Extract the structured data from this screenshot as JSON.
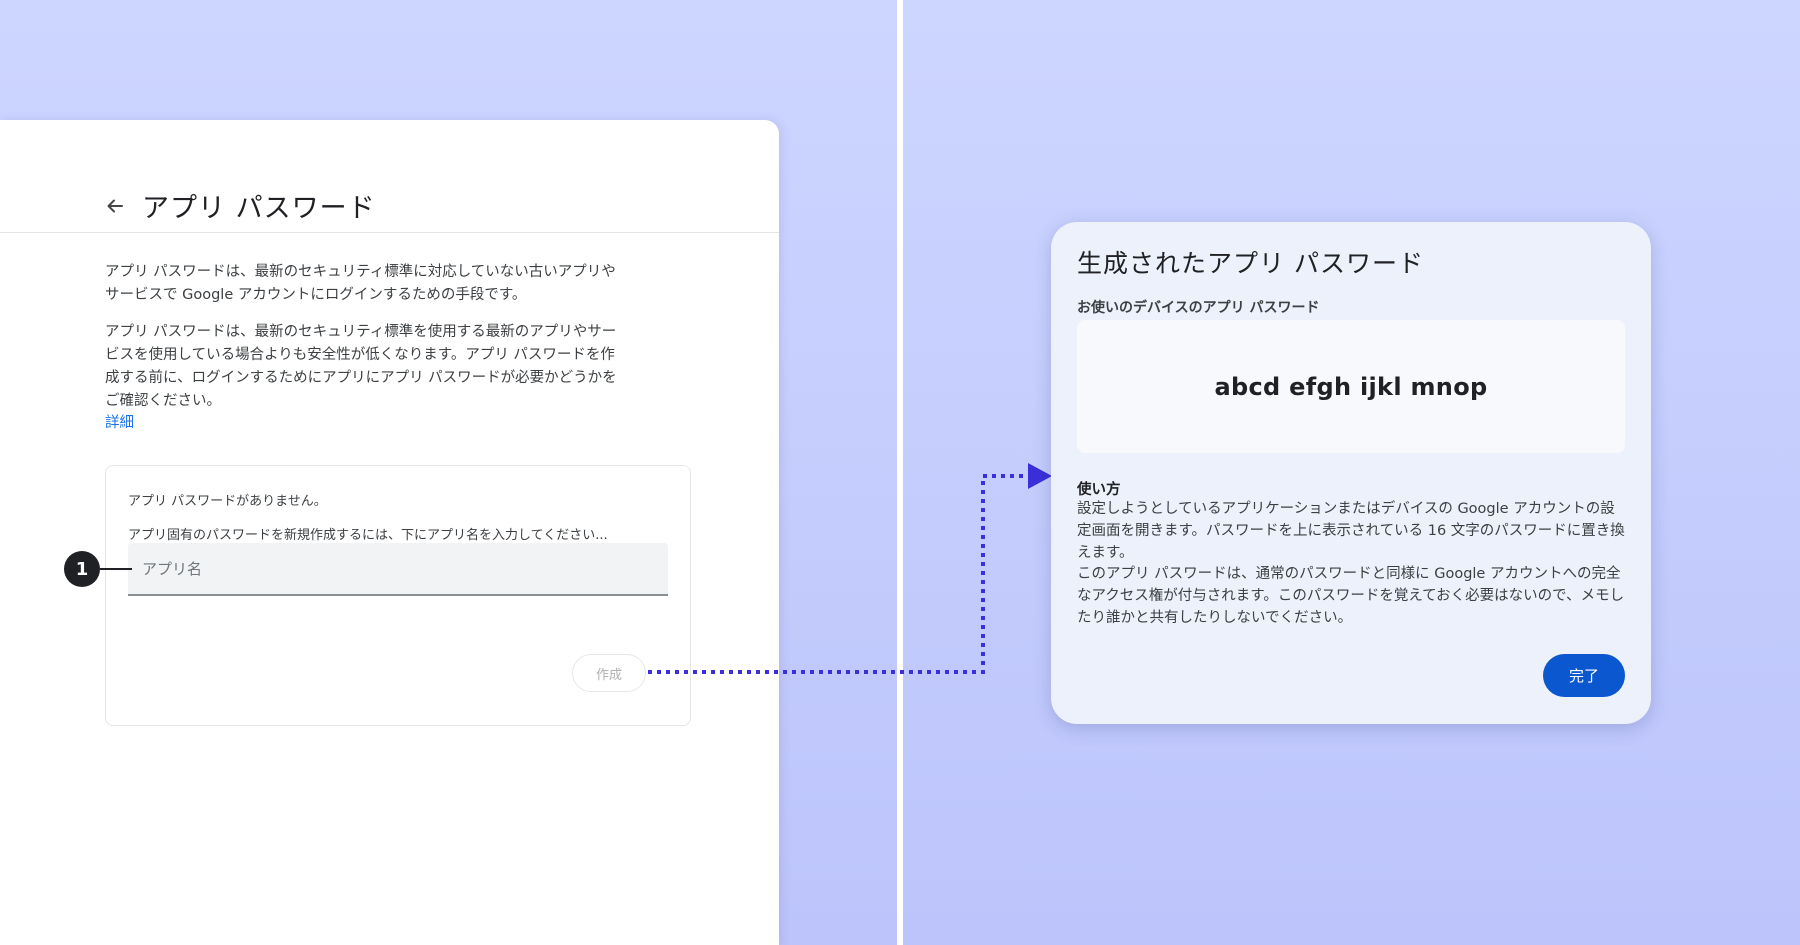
{
  "left": {
    "title": "アプリ パスワード",
    "desc1": "アプリ パスワードは、最新のセキュリティ標準に対応していない古いアプリやサービスで Google アカウントにログインするための手段です。",
    "desc2": "アプリ パスワードは、最新のセキュリティ標準を使用する最新のアプリやサービスを使用している場合よりも安全性が低くなります。アプリ パスワードを作成する前に、ログインするためにアプリにアプリ パスワードが必要かどうかをご確認ください。",
    "learn_more": "詳細",
    "no_passwords": "アプリ パスワードがありません。",
    "instruction": "アプリ固有のパスワードを新規作成するには、下にアプリ名を入力してください...",
    "input_placeholder": "アプリ名",
    "input_value": "",
    "create_button": "作成",
    "callout_number": "1"
  },
  "dialog": {
    "title": "生成されたアプリ パスワード",
    "password_label": "お使いのデバイスのアプリ パスワード",
    "password_value": "abcd efgh ijkl mnop",
    "usage_title": "使い方",
    "usage_text1": "設定しようとしているアプリケーションまたはデバイスの Google アカウントの設定画面を開きます。パスワードを上に表示されている 16 文字のパスワードに置き換えます。",
    "usage_text2": "このアプリ パスワードは、通常のパスワードと同様に Google アカウントへの完全なアクセス権が付与されます。このパスワードを覚えておく必要はないので、メモしたり誰かと共有したりしないでください。",
    "done_button": "完了"
  },
  "colors": {
    "background": "#c7cffd",
    "accent": "#0b57d0",
    "link": "#1a73e8",
    "connector": "#3b2fd9"
  },
  "icons": {
    "back": "arrow-back-icon",
    "arrow": "arrow-head-icon"
  }
}
